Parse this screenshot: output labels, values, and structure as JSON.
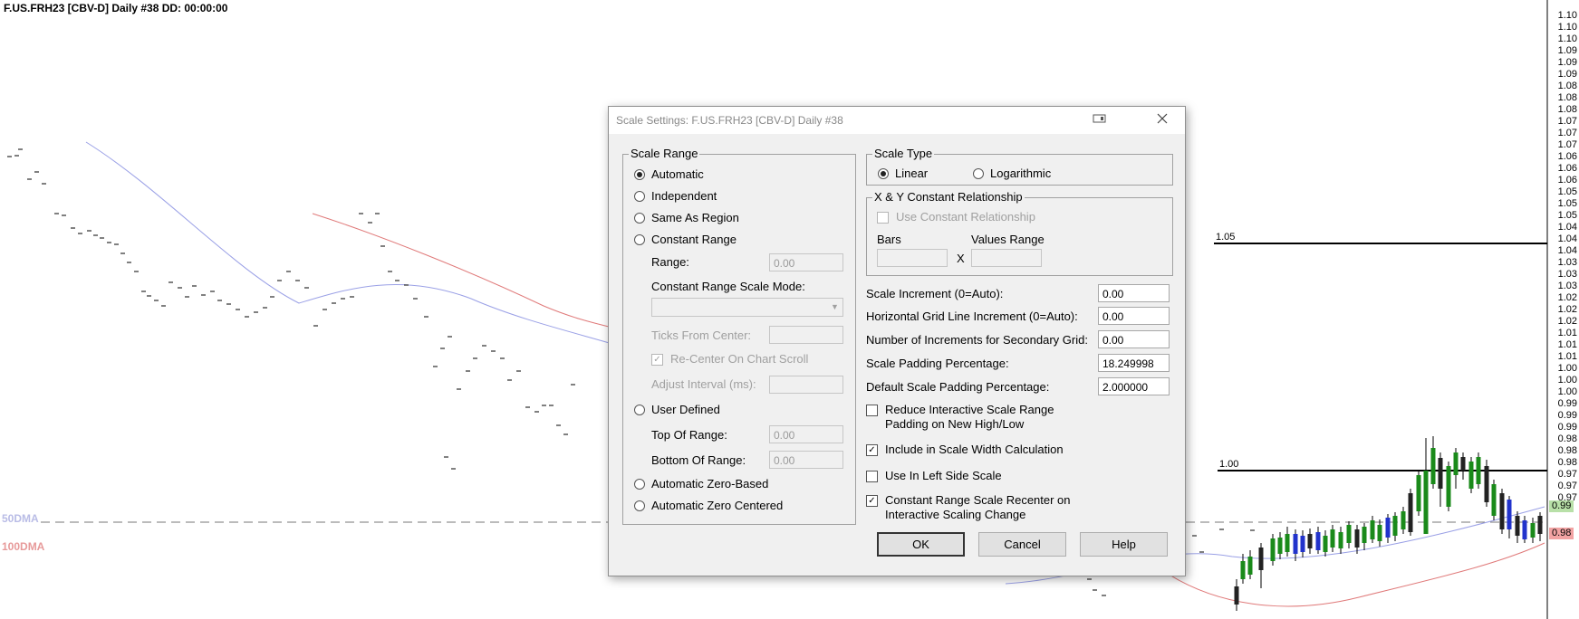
{
  "chart": {
    "title": "F.US.FRH23 [CBV-D]  Daily  #38 DD: 00:00:00",
    "ma_labels": [
      {
        "text": "50DMA",
        "color": "#b9bce6"
      },
      {
        "text": "100DMA",
        "color": "#e79a9a"
      }
    ],
    "axis_ticks": [
      "1.10",
      "1.10",
      "1.10",
      "1.09",
      "1.09",
      "1.09",
      "1.08",
      "1.08",
      "1.08",
      "1.07",
      "1.07",
      "1.07",
      "1.06",
      "1.06",
      "1.06",
      "1.05",
      "1.05",
      "1.05",
      "1.04",
      "1.04",
      "1.04",
      "1.03",
      "1.03",
      "1.03",
      "1.02",
      "1.02",
      "1.02",
      "1.01",
      "1.01",
      "1.01",
      "1.00",
      "1.00",
      "1.00",
      "0.99",
      "0.99",
      "0.99",
      "0.98",
      "0.98",
      "0.98",
      "0.97",
      "0.97",
      "0.97"
    ],
    "hlines": [
      {
        "label": "1.05",
        "value": 1.05
      },
      {
        "label": "1.00",
        "value": 1.0
      }
    ],
    "price_tags": [
      {
        "text": "0.99",
        "bg": "#b8e0a8",
        "value": 0.992
      },
      {
        "text": "0.98",
        "bg": "#f2a3a3",
        "value": 0.986
      }
    ],
    "colors": {
      "ma50": "#9aa0e6",
      "ma100": "#e07a7a",
      "bull": "#1a8a1a",
      "bear": "#222222",
      "blue": "#2233cc"
    }
  },
  "dialog": {
    "title": "Scale Settings: F.US.FRH23 [CBV-D]  Daily  #38",
    "scale_range": {
      "legend": "Scale Range",
      "automatic": "Automatic",
      "independent": "Independent",
      "same_as_region": "Same As Region",
      "constant_range": "Constant Range",
      "range_label": "Range:",
      "range_value": "0.00",
      "crsm_label": "Constant Range Scale Mode:",
      "ticks_label": "Ticks From Center:",
      "recenter_label": "Re-Center On Chart Scroll",
      "adjust_label": "Adjust Interval (ms):",
      "user_defined": "User Defined",
      "top_label": "Top Of Range:",
      "top_value": "0.00",
      "bottom_label": "Bottom Of Range:",
      "bottom_value": "0.00",
      "auto_zero_based": "Automatic Zero-Based",
      "auto_zero_centered": "Automatic Zero Centered",
      "selected": "automatic"
    },
    "scale_type": {
      "legend": "Scale Type",
      "linear": "Linear",
      "log": "Logarithmic",
      "selected": "linear"
    },
    "xy": {
      "legend": "X & Y Constant Relationship",
      "use_label": "Use Constant Relationship",
      "bars_label": "Bars",
      "values_label": "Values Range",
      "x_label": "X"
    },
    "fields": {
      "scale_increment_label": "Scale Increment (0=Auto):",
      "scale_increment": "0.00",
      "hgrid_label": "Horizontal Grid Line Increment (0=Auto):",
      "hgrid": "0.00",
      "secondary_label": "Number of Increments for Secondary Grid:",
      "secondary": "0.00",
      "padding_label": "Scale Padding Percentage:",
      "padding": "18.249998",
      "default_padding_label": "Default Scale Padding Percentage:",
      "default_padding": "2.000000"
    },
    "checks": {
      "reduce": {
        "label": "Reduce Interactive Scale Range Padding on New High/Low",
        "checked": false
      },
      "include": {
        "label": "Include in Scale Width Calculation",
        "checked": true
      },
      "left": {
        "label": "Use In Left Side Scale",
        "checked": false
      },
      "recenter": {
        "label": "Constant Range Scale Recenter on Interactive Scaling Change",
        "checked": true
      }
    },
    "buttons": {
      "ok": "OK",
      "cancel": "Cancel",
      "help": "Help"
    }
  }
}
